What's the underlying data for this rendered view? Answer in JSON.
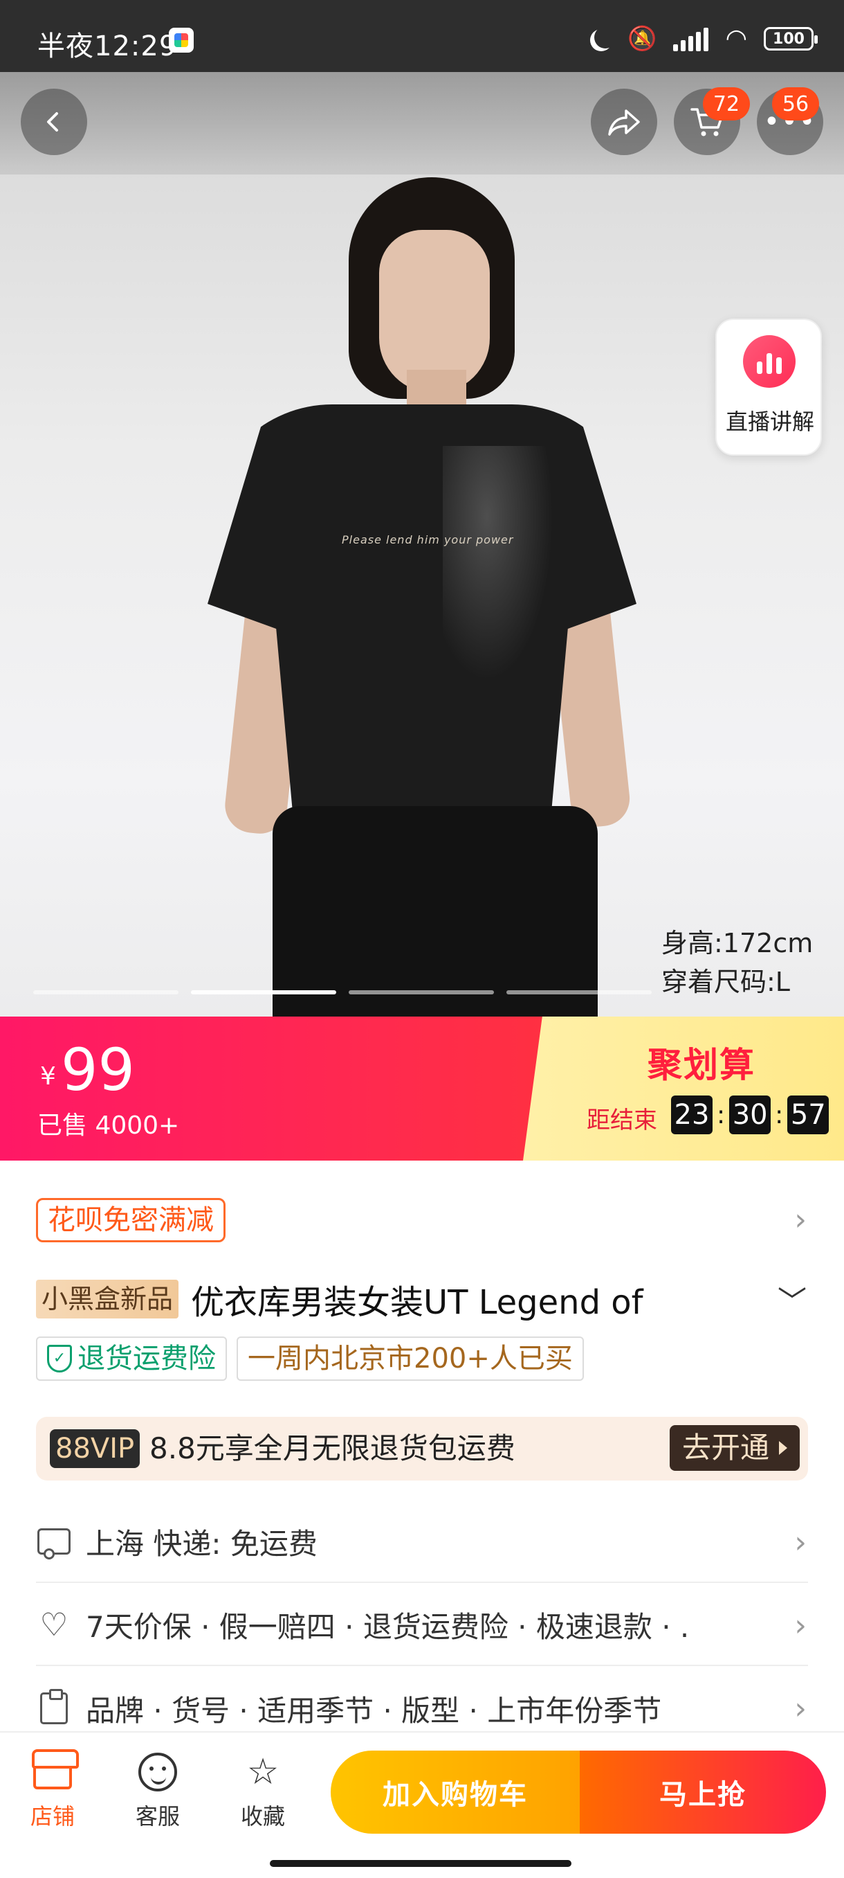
{
  "status_bar": {
    "time": "半夜12:29",
    "battery": "100"
  },
  "header": {
    "cart_count": "72",
    "more_count": "56"
  },
  "hero": {
    "live_label": "直播讲解",
    "shirt_print": "Please lend him your power",
    "model_height": "身高:172cm",
    "model_size": "穿着尺码:L",
    "pager_total": 4,
    "pager_active": 2
  },
  "price": {
    "currency": "¥",
    "amount": "99",
    "sold": "已售 4000+",
    "promo_title": "聚划算",
    "ends_label": "距结束",
    "timer": {
      "h": "23",
      "m": "30",
      "s": "57"
    },
    "colors": {
      "banner": "#ff1866",
      "promo_bg": "#fff0a8",
      "promo_text": "#ff1f3d"
    }
  },
  "info": {
    "huabei_tag": "花呗免密满减",
    "new_tag": "小黑盒新品",
    "title": "优衣库男装女装UT Legend of",
    "return_tag": "退货运费险",
    "buyers_tag": "一周内北京市200+人已买",
    "vip_badge": "88VIP",
    "vip_text": "8.8元享全月无限退货包运费",
    "vip_button": "去开通",
    "shipping": "上海  快递:  免运费",
    "guarantees": "7天价保 · 假一赔四 · 退货运费险 · 极速退款 · .",
    "params": "品牌 · 货号 · 适用季节 · 版型 · 上市年份季节"
  },
  "bottom_bar": {
    "store": "店铺",
    "service": "客服",
    "favorite": "收藏",
    "add_cart": "加入购物车",
    "buy_now": "马上抢"
  }
}
